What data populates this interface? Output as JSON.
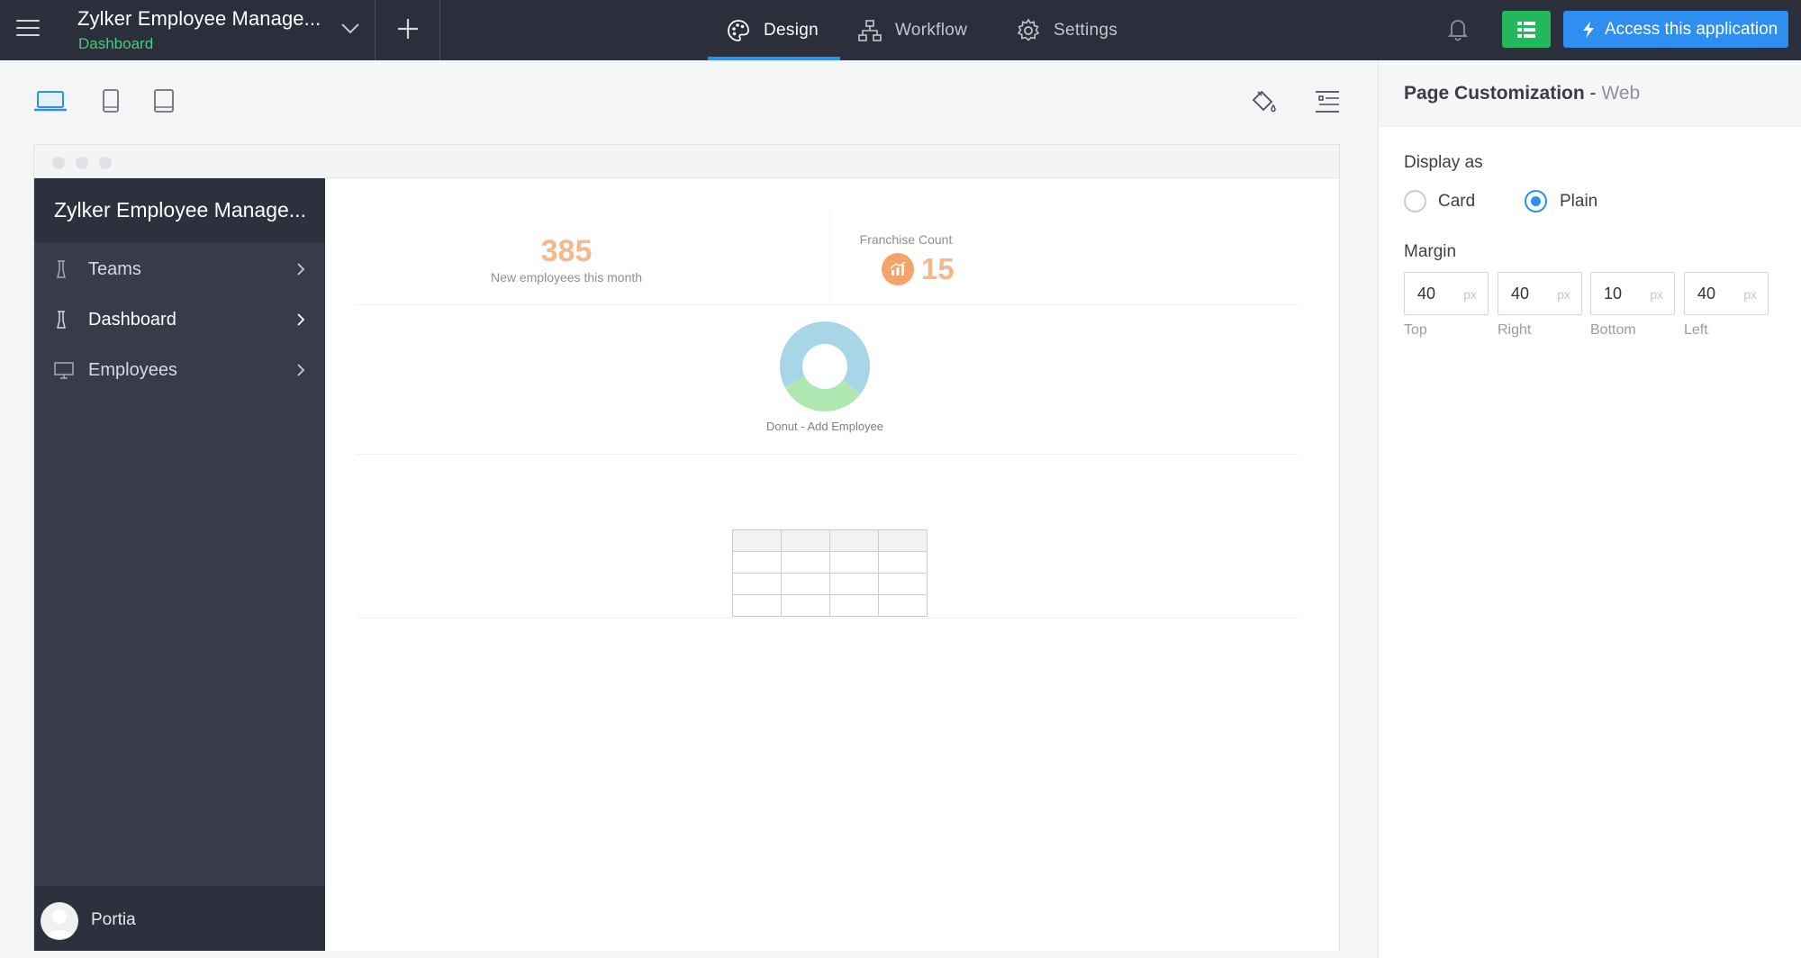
{
  "header": {
    "app_title": "Zylker Employee Manage...",
    "app_subtitle": "Dashboard",
    "tabs": [
      {
        "label": "Design",
        "icon": "palette-icon",
        "active": true
      },
      {
        "label": "Workflow",
        "icon": "workflow-icon",
        "active": false
      },
      {
        "label": "Settings",
        "icon": "gear-icon",
        "active": false
      }
    ],
    "access_button": "Access this application",
    "colors": {
      "topbar": "#2b2f3b",
      "accent": "#2e8ff0",
      "green": "#23b85b",
      "subtitle": "#3fd07a"
    }
  },
  "toolbar": {
    "devices": [
      "laptop-icon",
      "tablet-icon",
      "mobile-icon"
    ],
    "tools": [
      "paint-bucket-icon",
      "layout-list-icon"
    ]
  },
  "preview": {
    "sidebar": {
      "title": "Zylker Employee Manage...",
      "items": [
        {
          "label": "Teams",
          "icon": "flask-icon",
          "active": false
        },
        {
          "label": "Dashboard",
          "icon": "flask-icon",
          "active": true
        },
        {
          "label": "Employees",
          "icon": "monitor-icon",
          "active": false
        }
      ],
      "user": "Portia"
    },
    "kpi": {
      "value": "385",
      "label": "New employees this month"
    },
    "franchise": {
      "title": "Franchise Count",
      "value": "15"
    },
    "donut": {
      "label": "Donut - Add Employee",
      "segments": [
        {
          "color": "#a9d5e9",
          "share": 0.68
        },
        {
          "color": "#aee8b0",
          "share": 0.32
        }
      ]
    },
    "table": {
      "rows": 4,
      "cols": 4
    }
  },
  "panel": {
    "title": "Page Customization",
    "separator": " - ",
    "title_suffix": "Web",
    "display_as_label": "Display as",
    "options": [
      {
        "label": "Card",
        "selected": false
      },
      {
        "label": "Plain",
        "selected": true
      }
    ],
    "margin_label": "Margin",
    "unit": "px",
    "margins": [
      {
        "value": "40",
        "caption": "Top"
      },
      {
        "value": "40",
        "caption": "Right"
      },
      {
        "value": "10",
        "caption": "Bottom"
      },
      {
        "value": "40",
        "caption": "Left"
      }
    ]
  }
}
